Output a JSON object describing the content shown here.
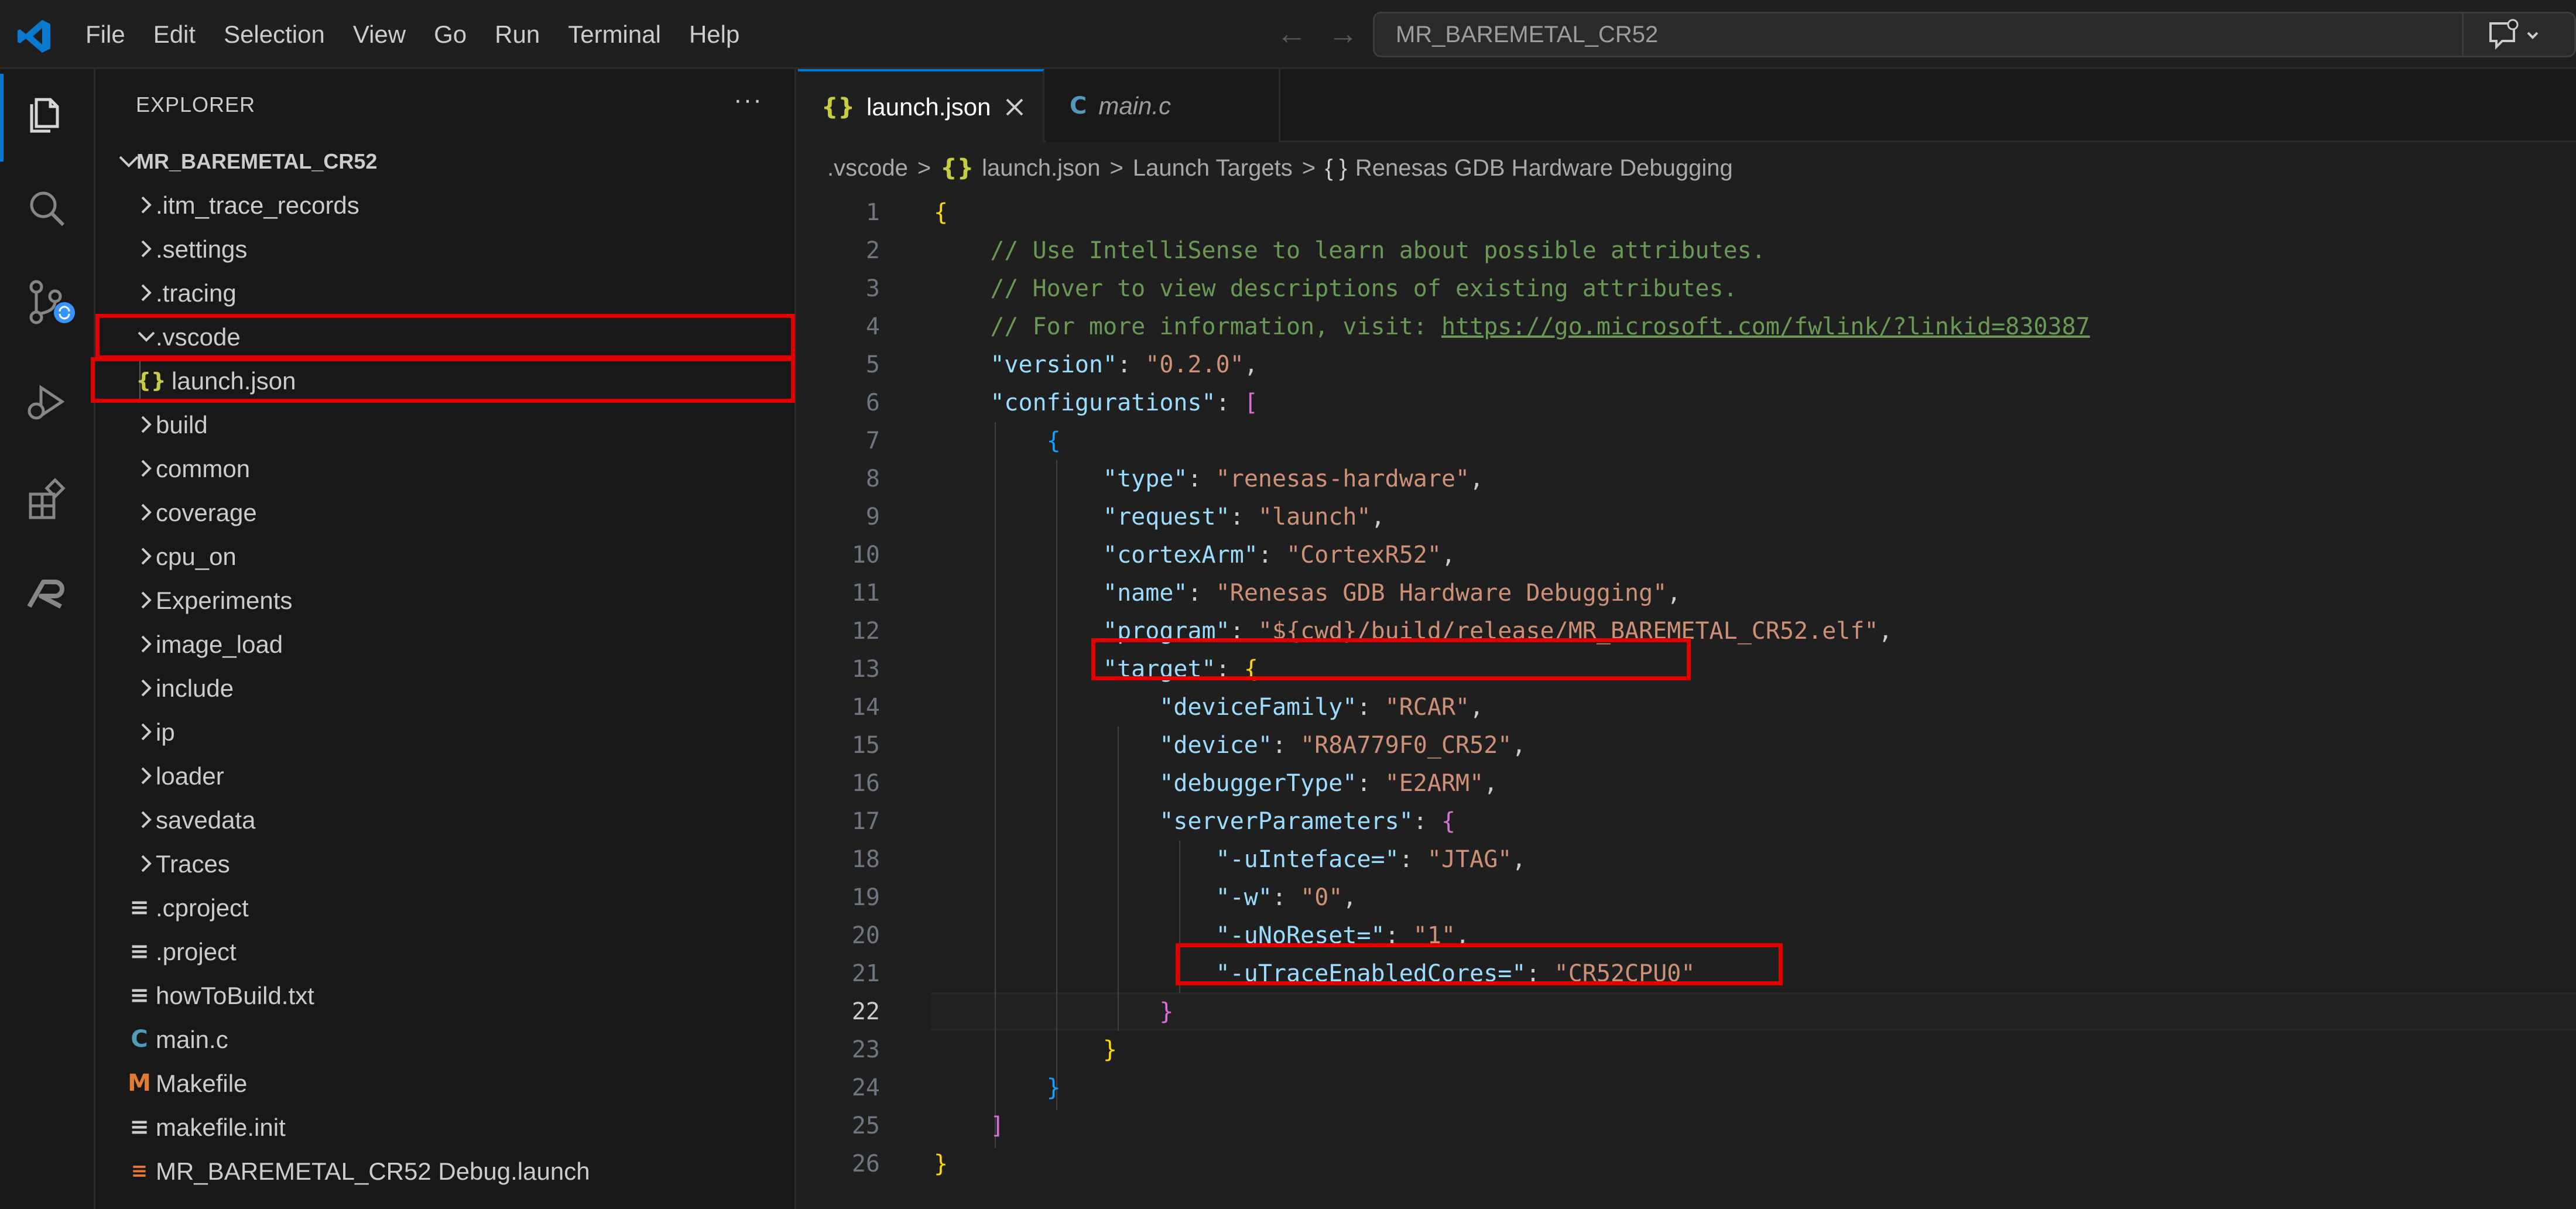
{
  "menubar": [
    "File",
    "Edit",
    "Selection",
    "View",
    "Go",
    "Run",
    "Terminal",
    "Help"
  ],
  "command_center": {
    "text": "MR_BAREMETAL_CR52"
  },
  "activity_icons": [
    "explorer-icon",
    "search-icon",
    "source-control-icon",
    "run-debug-icon",
    "extensions-icon",
    "renesas-icon"
  ],
  "sidebar": {
    "title": "EXPLORER",
    "more": "···",
    "root": "MR_BAREMETAL_CR52",
    "items": [
      {
        "label": ".itm_trace_records",
        "kind": "folder"
      },
      {
        "label": ".settings",
        "kind": "folder"
      },
      {
        "label": ".tracing",
        "kind": "folder"
      },
      {
        "label": ".vscode",
        "kind": "folder-open"
      },
      {
        "label": "launch.json",
        "kind": "json"
      },
      {
        "label": "build",
        "kind": "folder"
      },
      {
        "label": "common",
        "kind": "folder"
      },
      {
        "label": "coverage",
        "kind": "folder"
      },
      {
        "label": "cpu_on",
        "kind": "folder"
      },
      {
        "label": "Experiments",
        "kind": "folder"
      },
      {
        "label": "image_load",
        "kind": "folder"
      },
      {
        "label": "include",
        "kind": "folder"
      },
      {
        "label": "ip",
        "kind": "folder"
      },
      {
        "label": "loader",
        "kind": "folder"
      },
      {
        "label": "savedata",
        "kind": "folder"
      },
      {
        "label": "Traces",
        "kind": "folder"
      },
      {
        "label": ".cproject",
        "kind": "file"
      },
      {
        "label": ".project",
        "kind": "file"
      },
      {
        "label": "howToBuild.txt",
        "kind": "file"
      },
      {
        "label": "main.c",
        "kind": "c"
      },
      {
        "label": "Makefile",
        "kind": "makefile"
      },
      {
        "label": "makefile.init",
        "kind": "file"
      },
      {
        "label": "MR_BAREMETAL_CR52 Debug.launch",
        "kind": "launch"
      }
    ]
  },
  "tabs": [
    {
      "label": "launch.json",
      "icon": "{}"
    },
    {
      "label": "main.c",
      "icon": "C"
    }
  ],
  "breadcrumbs": {
    "folder": ".vscode",
    "file_icon": "{}",
    "file": "launch.json",
    "section": "Launch Targets",
    "obj_icon": "{ }",
    "item": "Renesas GDB Hardware Debugging"
  },
  "code": {
    "lines": [
      "1",
      "2",
      "3",
      "4",
      "5",
      "6",
      "7",
      "8",
      "9",
      "10",
      "11",
      "12",
      "13",
      "14",
      "15",
      "16",
      "17",
      "18",
      "19",
      "20",
      "21",
      "22",
      "23",
      "24",
      "25",
      "26"
    ],
    "comment1": "// Use IntelliSense to learn about possible attributes.",
    "comment2": "// Hover to view descriptions of existing attributes.",
    "comment3_prefix": "// For more information, visit: ",
    "comment3_link": "https://go.microsoft.com/fwlink/?linkid=830387",
    "version_key": "\"version\"",
    "version_val": "\"0.2.0\"",
    "configurations_key": "\"configurations\"",
    "type_key": "\"type\"",
    "type_val": "\"renesas-hardware\"",
    "request_key": "\"request\"",
    "request_val": "\"launch\"",
    "cortex_key": "\"cortexArm\"",
    "cortex_val": "\"CortexR52\"",
    "name_key": "\"name\"",
    "name_val": "\"Renesas GDB Hardware Debugging\"",
    "program_key": "\"program\"",
    "program_val": "\"${cwd}/build/release/MR_BAREMETAL_CR52.elf\"",
    "target_key": "\"target\"",
    "devfam_key": "\"deviceFamily\"",
    "devfam_val": "\"RCAR\"",
    "device_key": "\"device\"",
    "device_val": "\"R8A779F0_CR52\"",
    "dbgtype_key": "\"debuggerType\"",
    "dbgtype_val": "\"E2ARM\"",
    "server_key": "\"serverParameters\"",
    "uif_key": "\"-uInteface=\"",
    "uif_val": "\"JTAG\"",
    "w_key": "\"-w\"",
    "w_val": "\"0\"",
    "noreset_key": "\"-uNoReset=\"",
    "noreset_val": "\"1\"",
    "trace_key": "\"-uTraceEnabledCores=\"",
    "trace_val": "\"CR52CPU0\""
  },
  "colors": {
    "highlight": "#e00000",
    "accent": "#0078d4"
  }
}
